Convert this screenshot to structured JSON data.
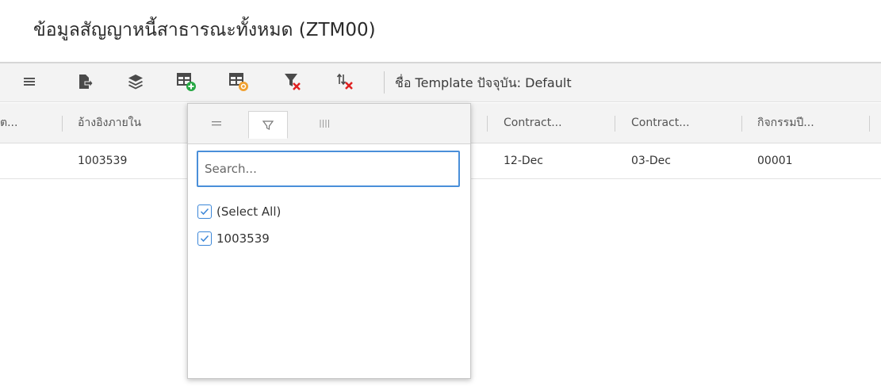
{
  "page": {
    "title": "ข้อมูลสัญญาหนี้สาธารณะทั้งหมด (ZTM00)"
  },
  "toolbar": {
    "template_text": "ชื่อ Template ปัจจุบัน: Default",
    "buttons": [
      {
        "icon": "menu-icon"
      },
      {
        "icon": "export-icon"
      },
      {
        "icon": "layers-icon"
      },
      {
        "icon": "add-table-icon"
      },
      {
        "icon": "table-settings-icon"
      },
      {
        "icon": "clear-filter-icon"
      },
      {
        "icon": "clear-sort-icon"
      }
    ]
  },
  "grid": {
    "headers": [
      "ต...",
      "อ้างอิงภายใน",
      "Contract...",
      "Contract...",
      "กิจกรรมปี..."
    ],
    "rows": [
      {
        "col1": "",
        "col2": "1003539",
        "col3": "12-Dec",
        "col4": "03-Dec",
        "col5": "00001"
      }
    ]
  },
  "filter_popup": {
    "tabs": [
      {
        "icon": "menu-icon"
      },
      {
        "icon": "filter-icon"
      },
      {
        "icon": "columns-icon"
      }
    ],
    "active_tab": 1,
    "search_placeholder": "Search...",
    "options": [
      {
        "label": "(Select All)",
        "checked": true
      },
      {
        "label": "1003539",
        "checked": true
      }
    ]
  },
  "colors": {
    "accent": "#3b86d8",
    "green_badge": "#27a844",
    "orange_badge": "#f0a030",
    "red_x": "#e02020"
  }
}
